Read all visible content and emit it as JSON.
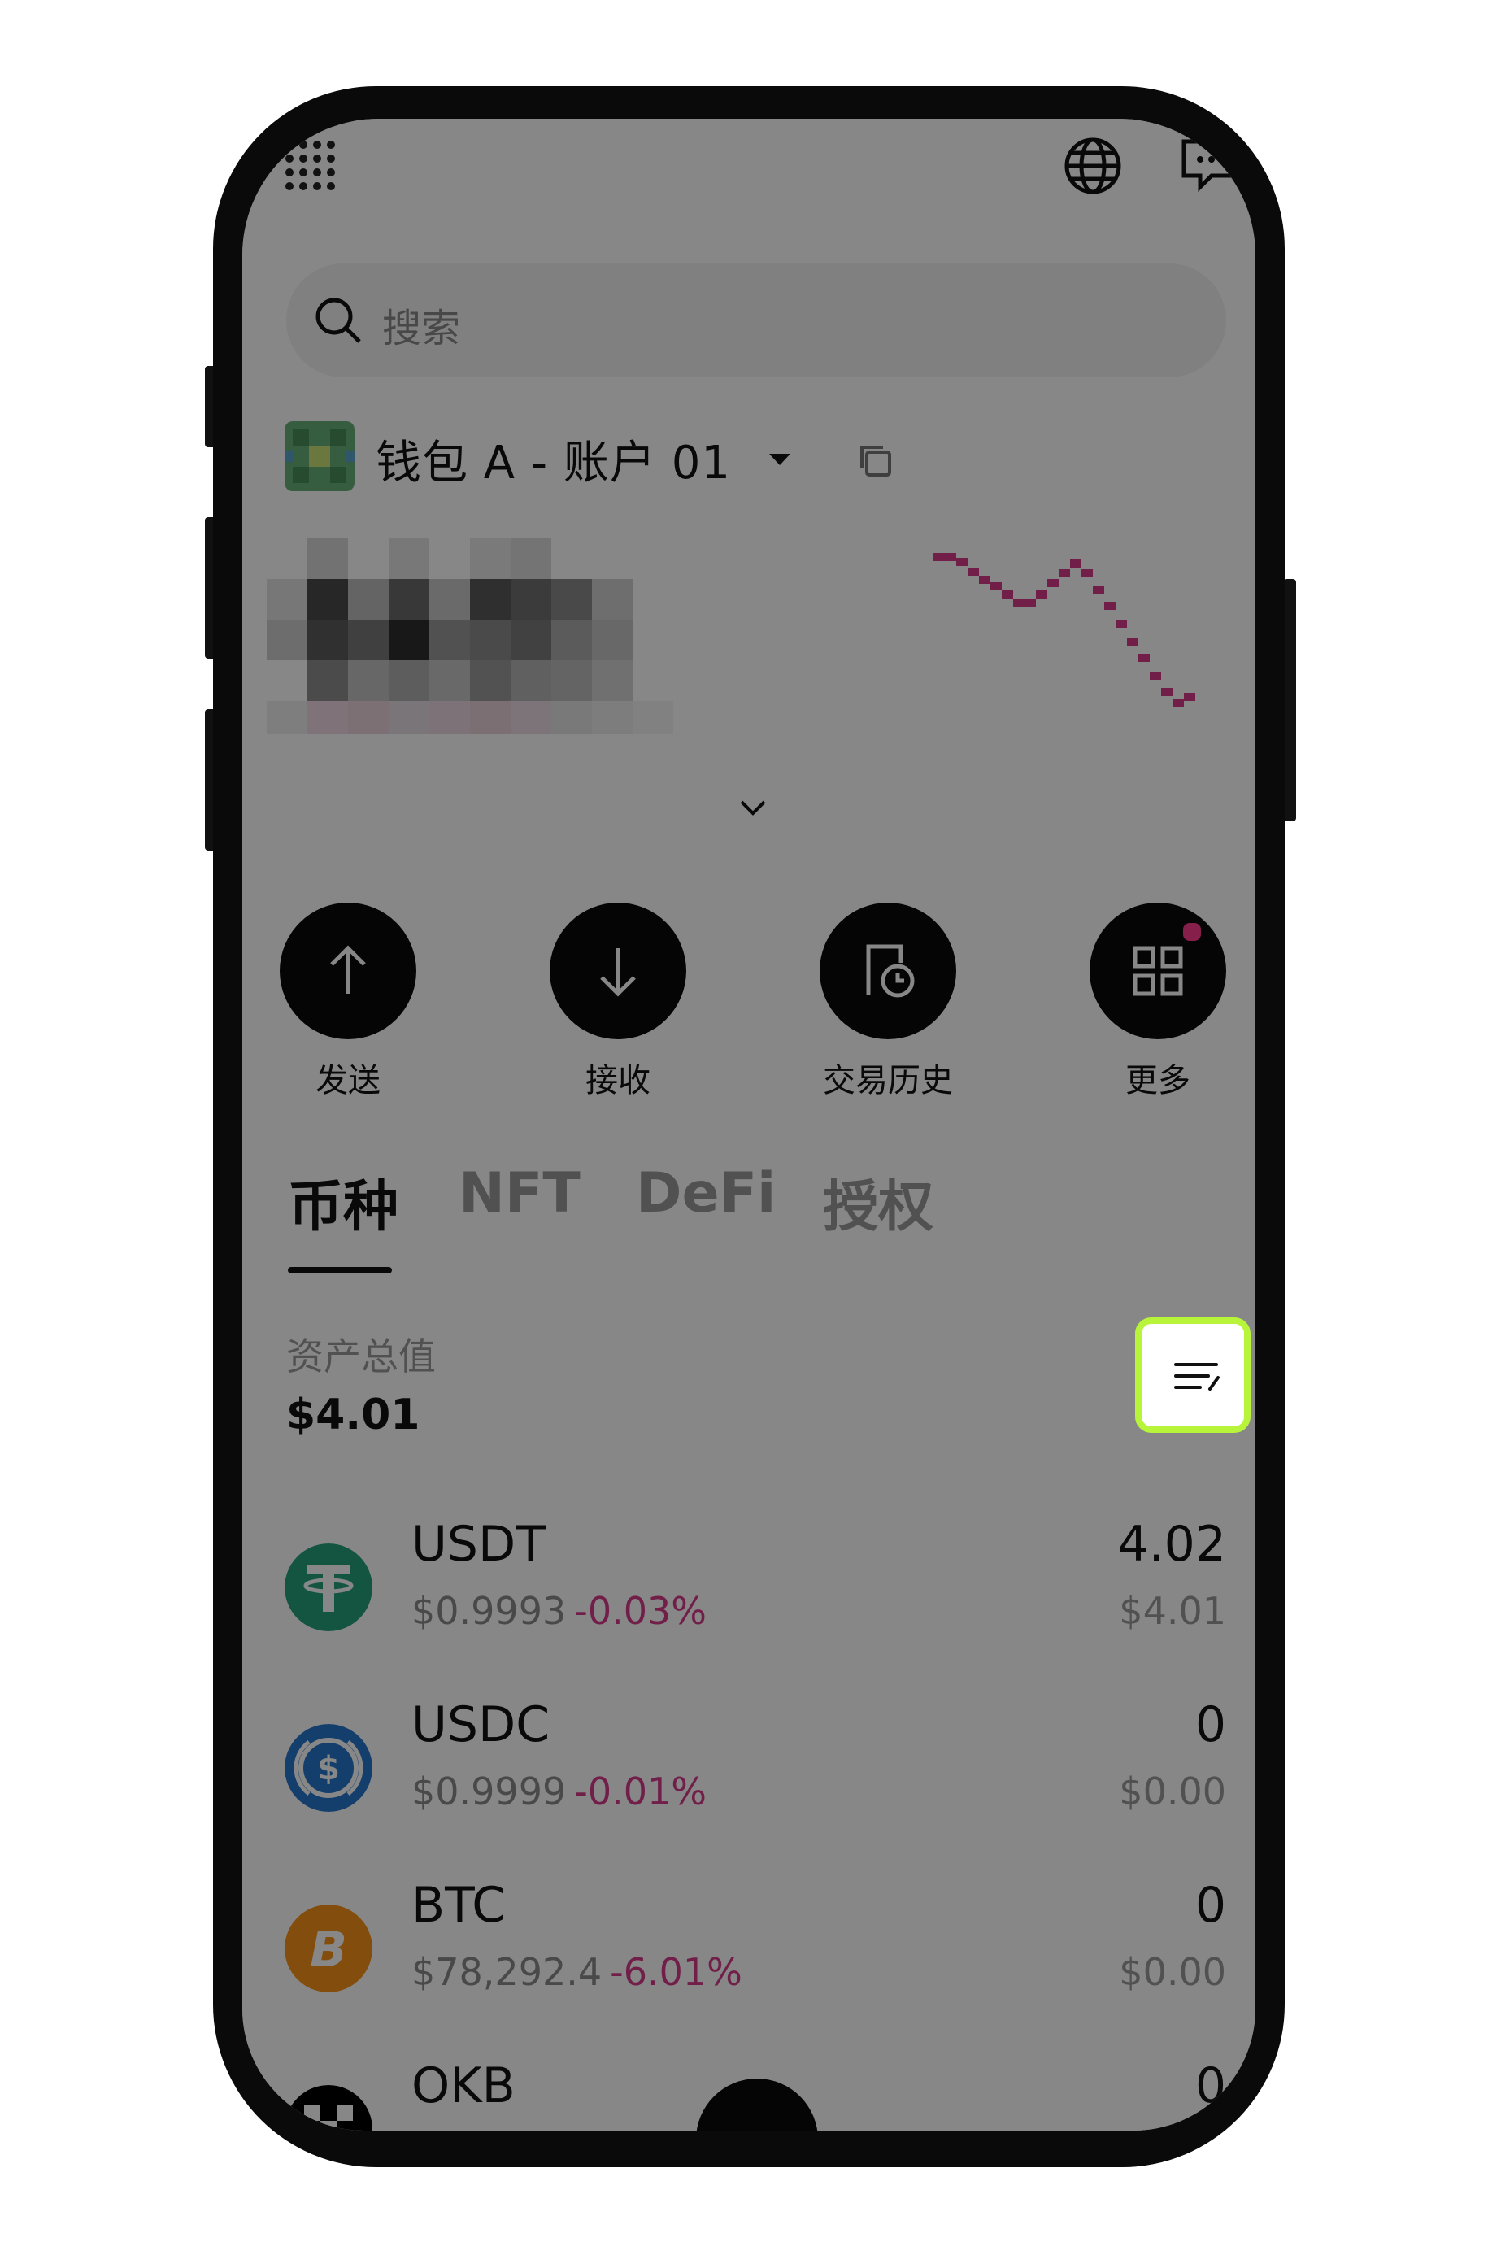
{
  "search": {
    "placeholder": "搜索"
  },
  "wallet": {
    "name": "钱包 A - 账户 01"
  },
  "actions": [
    {
      "label": "发送",
      "icon": "arrow-up-icon"
    },
    {
      "label": "接收",
      "icon": "arrow-down-icon"
    },
    {
      "label": "交易历史",
      "icon": "history-icon"
    },
    {
      "label": "更多",
      "icon": "apps-icon"
    }
  ],
  "tabs": [
    "币种",
    "NFT",
    "DeFi",
    "授权"
  ],
  "total": {
    "label": "资产总值",
    "value": "$4.01"
  },
  "tokens": [
    {
      "symbol": "USDT",
      "price": "$0.9993",
      "change": "-0.03%",
      "amount": "4.02",
      "usd": "$4.01",
      "color": "#26a17b"
    },
    {
      "symbol": "USDC",
      "price": "$0.9999",
      "change": "-0.01%",
      "amount": "0",
      "usd": "$0.00",
      "color": "#2775ca"
    },
    {
      "symbol": "BTC",
      "price": "$78,292.4",
      "change": "-6.01%",
      "amount": "0",
      "usd": "$0.00",
      "color": "#f7931a"
    },
    {
      "symbol": "OKB",
      "price": "",
      "change": "",
      "amount": "0",
      "usd": "",
      "color": "#000000"
    }
  ],
  "colors": {
    "highlight": "#b8f53a",
    "negative": "#d63a8a",
    "sparkline": "#d63a8a"
  }
}
